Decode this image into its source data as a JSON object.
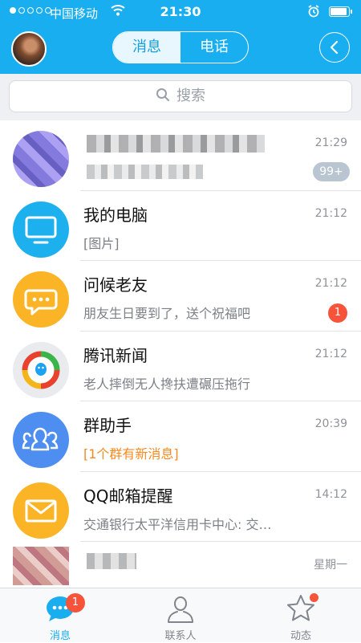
{
  "status": {
    "carrier": "中国移动",
    "time": "21:30"
  },
  "header": {
    "tab_messages": "消息",
    "tab_calls": "电话"
  },
  "search": {
    "placeholder": "搜索"
  },
  "conversations": [
    {
      "name": "",
      "preview": "",
      "time": "21:29",
      "badge": "99+"
    },
    {
      "name": "我的电脑",
      "preview": "[图片]",
      "time": "21:12",
      "badge": ""
    },
    {
      "name": "问候老友",
      "preview": "朋友生日要到了，送个祝福吧",
      "time": "21:12",
      "badge": "1"
    },
    {
      "name": "腾讯新闻",
      "preview": "老人摔倒无人搀扶遭碾压拖行",
      "time": "21:12",
      "badge": ""
    },
    {
      "name": "群助手",
      "preview": "[1个群有新消息]",
      "time": "20:39",
      "badge": ""
    },
    {
      "name": "QQ邮箱提醒",
      "preview": "交通银行太平洋信用卡中心: 交…",
      "time": "14:12",
      "badge": ""
    },
    {
      "name": "",
      "preview": "",
      "time": "星期一",
      "badge": ""
    }
  ],
  "tabbar": {
    "messages_label": "消息",
    "messages_badge": "1",
    "contacts_label": "联系人",
    "activity_label": "动态"
  },
  "colors": {
    "accent": "#19aef0",
    "badge": "#f6533a",
    "highlight_text": "#f58a1f"
  },
  "icons": {
    "status": [
      "signal-dots-icon",
      "wifi-icon",
      "alarm-icon",
      "battery-icon"
    ],
    "header": [
      "user-avatar",
      "back-arrow-icon"
    ],
    "rows": [
      "blurred-avatar",
      "computer-monitor-icon",
      "chat-bubble-icon",
      "tencent-news-icon",
      "group-people-icon",
      "mail-envelope-icon",
      "blurred-avatar"
    ],
    "tabbar": [
      "chat-bubble-icon",
      "person-icon",
      "star-icon"
    ]
  }
}
